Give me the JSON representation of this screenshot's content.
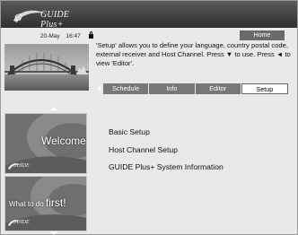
{
  "header": {
    "logo_text": "GUIDE Plus+",
    "logo_badge": "plus"
  },
  "status": {
    "date": "20-May",
    "time": "16:47",
    "lock_icon": "lock-icon"
  },
  "home_button_label": "Home",
  "description": "'Setup' allows you to define your language, country postal code, external receiver and Host Channel. Press ▼ to use. Press ◄ to view 'Editor'.",
  "tabs": [
    {
      "label": "Schedule",
      "active": false
    },
    {
      "label": "Info",
      "active": false
    },
    {
      "label": "Editor",
      "active": false
    },
    {
      "label": "Setup",
      "active": true
    }
  ],
  "tiles": {
    "welcome": "Welcome!",
    "first_prefix": "What to do",
    "first_emph": "first!",
    "logo_text": "GUIDE"
  },
  "menu": {
    "items": [
      "Basic Setup",
      "Host Channel Setup",
      "GUIDE Plus+ System Information"
    ]
  },
  "colors": {
    "band": "#3f3f3f",
    "tab_inactive": "#777777",
    "tab_active": "#ffffff",
    "background": "#e9e9e9"
  }
}
